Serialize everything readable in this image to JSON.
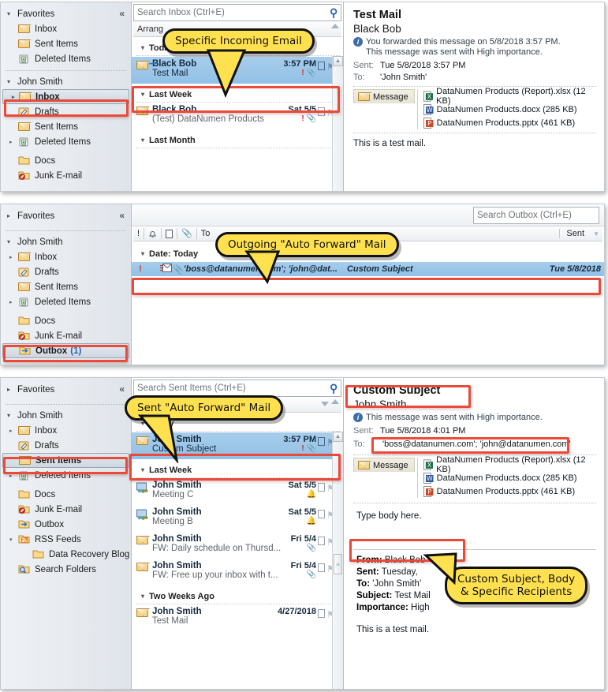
{
  "shots": {
    "inbox": {
      "nav": {
        "favorites_label": "Favorites",
        "favorites_items": [
          "Inbox",
          "Sent Items",
          "Deleted Items"
        ],
        "account_label": "John Smith",
        "account_items": [
          {
            "label": "Inbox",
            "expandable": true,
            "selected": true
          },
          {
            "label": "Drafts",
            "expandable": false,
            "selected": false
          },
          {
            "label": "Sent Items",
            "expandable": false,
            "selected": false
          },
          {
            "label": "Deleted Items",
            "expandable": true,
            "selected": false
          },
          {
            "label": "Docs",
            "expandable": false,
            "selected": false
          },
          {
            "label": "Junk E-mail",
            "expandable": false,
            "selected": false
          }
        ]
      },
      "search_placeholder": "Search Inbox (Ctrl+E)",
      "arrange_label": "Arrang",
      "groups": [
        {
          "title": "Today",
          "rows": [
            {
              "from": "Black Bob",
              "subject": "Test Mail",
              "date": "3:57 PM",
              "selected": true,
              "forwarded": true,
              "importance": true,
              "attachment": true
            }
          ]
        },
        {
          "title": "Last Week",
          "rows": [
            {
              "from": "Black Bob",
              "subject": "(Test) DataNumen Products",
              "date": "Sat 5/5",
              "selected": false,
              "forwarded": false,
              "importance": true,
              "attachment": true
            }
          ]
        },
        {
          "title": "Last Month",
          "rows": []
        }
      ],
      "reading": {
        "subject": "Test Mail",
        "sender": "Black Bob",
        "info_line1": "You forwarded this message on 5/8/2018 3:57 PM.",
        "info_line2": "This message was sent with High importance.",
        "sent_key": "Sent:",
        "sent_value": "Tue 5/8/2018 3:57 PM",
        "to_key": "To:",
        "to_value": "'John Smith'",
        "message_tab": "Message",
        "attachments": [
          {
            "name": "DataNumen Products (Report).xlsx (12 KB)",
            "type": "xlsx"
          },
          {
            "name": "DataNumen Products.docx (285 KB)",
            "type": "docx"
          },
          {
            "name": "DataNumen Products.pptx (461 KB)",
            "type": "pptx"
          }
        ],
        "body": "This is a test mail."
      },
      "callout": "Specific Incoming Email"
    },
    "outbox": {
      "nav": {
        "favorites_label": "Favorites",
        "account_label": "John Smith",
        "account_items": [
          {
            "label": "Inbox",
            "expandable": true,
            "selected": false
          },
          {
            "label": "Drafts",
            "expandable": false,
            "selected": false
          },
          {
            "label": "Sent Items",
            "expandable": false,
            "selected": false
          },
          {
            "label": "Deleted Items",
            "expandable": true,
            "selected": false
          },
          {
            "label": "Docs",
            "expandable": false,
            "selected": false
          },
          {
            "label": "Junk E-mail",
            "expandable": false,
            "selected": false
          },
          {
            "label": "Outbox",
            "count": "(1)",
            "expandable": false,
            "selected": true
          }
        ]
      },
      "search_placeholder": "Search Outbox (Ctrl+E)",
      "columns": {
        "importance": "!",
        "reminder": "⌂",
        "icon": "⎕",
        "attachment": "\u0001",
        "to": "To",
        "sent": "Sent"
      },
      "group_title": "Date: Today",
      "row": {
        "to": "'boss@datanumen.com'; 'john@dat...",
        "subject": "Custom Subject",
        "sent": "Tue 5/8/2018 ",
        "importance": "!",
        "attachment": true
      },
      "callout": "Outgoing \"Auto Forward\" Mail"
    },
    "sent": {
      "nav": {
        "favorites_label": "Favorites",
        "account_label": "John Smith",
        "account_items": [
          {
            "label": "Inbox",
            "expandable": true,
            "selected": false
          },
          {
            "label": "Drafts",
            "expandable": false,
            "selected": false
          },
          {
            "label": "Sent Items",
            "expandable": false,
            "selected": true
          },
          {
            "label": "Deleted Items",
            "expandable": true,
            "selected": false
          },
          {
            "label": "Docs",
            "expandable": false,
            "selected": false
          },
          {
            "label": "Junk E-mail",
            "expandable": false,
            "selected": false
          },
          {
            "label": "Outbox",
            "expandable": false,
            "selected": false
          },
          {
            "label": "RSS Feeds",
            "expandable": true,
            "selected": false
          },
          {
            "label": "Data Recovery Blog",
            "expandable": false,
            "selected": false,
            "child": true
          },
          {
            "label": "Search Folders",
            "expandable": false,
            "selected": false
          }
        ]
      },
      "search_placeholder": "Search Sent Items (Ctrl+E)",
      "groups": [
        {
          "title": "Today",
          "rows": [
            {
              "from": "John Smith",
              "subject": "Custom Subject",
              "date": "3:57 PM",
              "selected": true,
              "importance": true,
              "attachment": true,
              "icon": "mail"
            }
          ]
        },
        {
          "title": "Last Week",
          "rows": [
            {
              "from": "John Smith",
              "subject": "Meeting C",
              "date": "Sat 5/5",
              "selected": false,
              "bell": true,
              "icon": "meeting"
            },
            {
              "from": "John Smith",
              "subject": "Meeting B",
              "date": "Sat 5/5",
              "selected": false,
              "bell": true,
              "icon": "meeting"
            },
            {
              "from": "John Smith",
              "subject": "FW: Daily schedule on Thursd...",
              "date": "Fri 5/4",
              "selected": false,
              "attachment": true,
              "icon": "mail"
            },
            {
              "from": "John Smith",
              "subject": "FW: Free up your inbox with t...",
              "date": "Fri 5/4",
              "selected": false,
              "attachment": true,
              "icon": "mail"
            }
          ]
        },
        {
          "title": "Two Weeks Ago",
          "rows": [
            {
              "from": "John Smith",
              "subject": "Test Mail",
              "date": "4/27/2018",
              "selected": false,
              "icon": "mail"
            }
          ]
        }
      ],
      "reading": {
        "subject": "Custom Subject",
        "sender": "John Smith",
        "info_line1": "This message was sent with High importance.",
        "sent_key": "Sent:",
        "sent_value": "Tue 5/8/2018 4:01 PM",
        "to_key": "To:",
        "to_value": "'boss@datanumen.com'; 'john@datanumen.com'",
        "message_tab": "Message",
        "attachments": [
          {
            "name": "DataNumen Products (Report).xlsx (12 KB)",
            "type": "xlsx"
          },
          {
            "name": "DataNumen Products.docx (285 KB)",
            "type": "docx"
          },
          {
            "name": "DataNumen Products.pptx (461 KB)",
            "type": "pptx"
          }
        ],
        "body": "Type body here.",
        "fwd_from_key": "From:",
        "fwd_from_value": "Black Bob",
        "fwd_sent_key": "Sent:",
        "fwd_sent_value": "Tuesday,",
        "fwd_to_key": "To:",
        "fwd_to_value": "'John Smith'",
        "fwd_subject_key": "Subject:",
        "fwd_subject_value": "Test Mail",
        "fwd_importance_key": "Importance:",
        "fwd_importance_value": "High",
        "fwd_body": "This is a test mail."
      },
      "callout_top": "Sent \"Auto Forward\" Mail",
      "callout_bottom": "Custom Subject, Body\n& Specific Recipients"
    }
  },
  "colors": {
    "accent_red": "#ea4a3a",
    "callout_yellow": "#ffe14f",
    "selection_blue": "#9cc6e8",
    "link_blue": "#2a62b6"
  }
}
